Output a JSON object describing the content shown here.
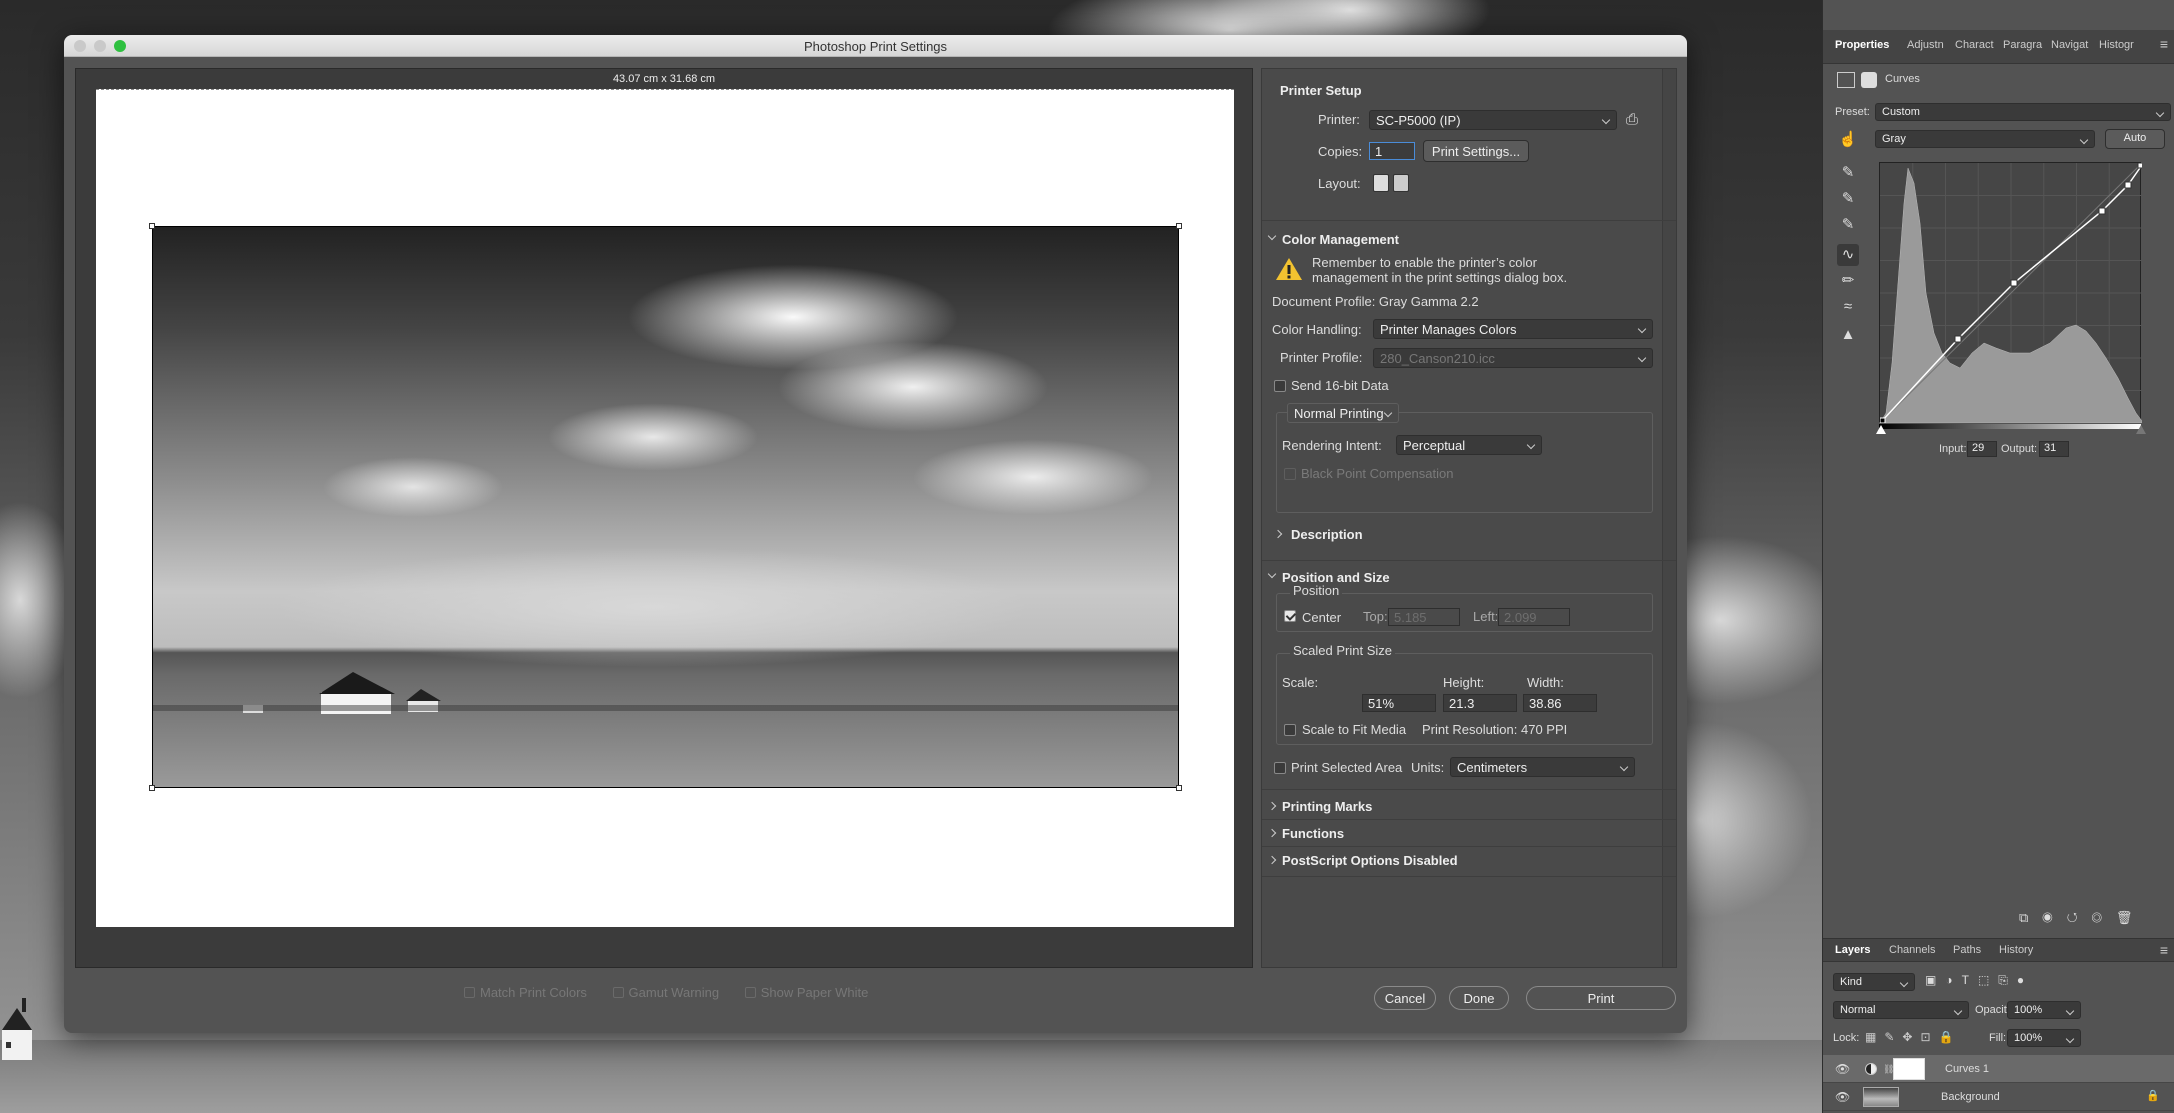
{
  "dialog": {
    "title": "Photoshop Print Settings",
    "preview_dims": "43.07 cm x 31.68 cm",
    "preview_options": [
      "Match Print Colors",
      "Gamut Warning",
      "Show Paper White"
    ],
    "buttons": {
      "cancel": "Cancel",
      "done": "Done",
      "print": "Print"
    }
  },
  "printer_setup": {
    "heading": "Printer Setup",
    "printer_label": "Printer:",
    "printer_value": "SC-P5000 (IP)",
    "copies_label": "Copies:",
    "copies_value": "1",
    "print_settings_btn": "Print Settings...",
    "layout_label": "Layout:"
  },
  "color_management": {
    "heading": "Color Management",
    "warning": "Remember to enable the printer’s color management in the print settings dialog box.",
    "document_profile": "Document Profile: Gray Gamma 2.2",
    "color_handling_label": "Color Handling:",
    "color_handling_value": "Printer Manages Colors",
    "printer_profile_label": "Printer Profile:",
    "printer_profile_value": "280_Canson210.icc",
    "send16_label": "Send 16-bit Data",
    "normal_printing": "Normal Printing",
    "rendering_intent_label": "Rendering Intent:",
    "rendering_intent_value": "Perceptual",
    "bpc_label": "Black Point Compensation",
    "description": "Description"
  },
  "position_size": {
    "heading": "Position and Size",
    "position_label": "Position",
    "center_label": "Center",
    "top_label": "Top:",
    "top_value": "5.185",
    "left_label": "Left:",
    "left_value": "2.099",
    "scaled_label": "Scaled Print Size",
    "scale_label": "Scale:",
    "scale_value": "51%",
    "height_label": "Height:",
    "height_value": "21.3",
    "width_label": "Width:",
    "width_value": "38.86",
    "fit_label": "Scale to Fit Media",
    "resolution": "Print Resolution: 470 PPI",
    "print_selected": "Print Selected Area",
    "units_label": "Units:",
    "units_value": "Centimeters"
  },
  "collapsed_sections": [
    "Printing Marks",
    "Functions",
    "PostScript Options Disabled"
  ],
  "properties": {
    "tabs": [
      "Properties",
      "Adjustn",
      "Charact",
      "Paragra",
      "Navigat",
      "Histogr"
    ],
    "panel_title": "Curves",
    "preset_label": "Preset:",
    "preset_value": "Custom",
    "channel_value": "Gray",
    "auto_btn": "Auto",
    "input_label": "Input:",
    "input_value": "29",
    "output_label": "Output:",
    "output_value": "31"
  },
  "layers": {
    "tabs": [
      "Layers",
      "Channels",
      "Paths",
      "History"
    ],
    "filter_value": "Kind",
    "blend_mode": "Normal",
    "opacity_label": "Opacity:",
    "opacity_value": "100%",
    "lock_label": "Lock:",
    "fill_label": "Fill:",
    "fill_value": "100%",
    "items": [
      {
        "name": "Curves 1"
      },
      {
        "name": "Background"
      }
    ]
  }
}
